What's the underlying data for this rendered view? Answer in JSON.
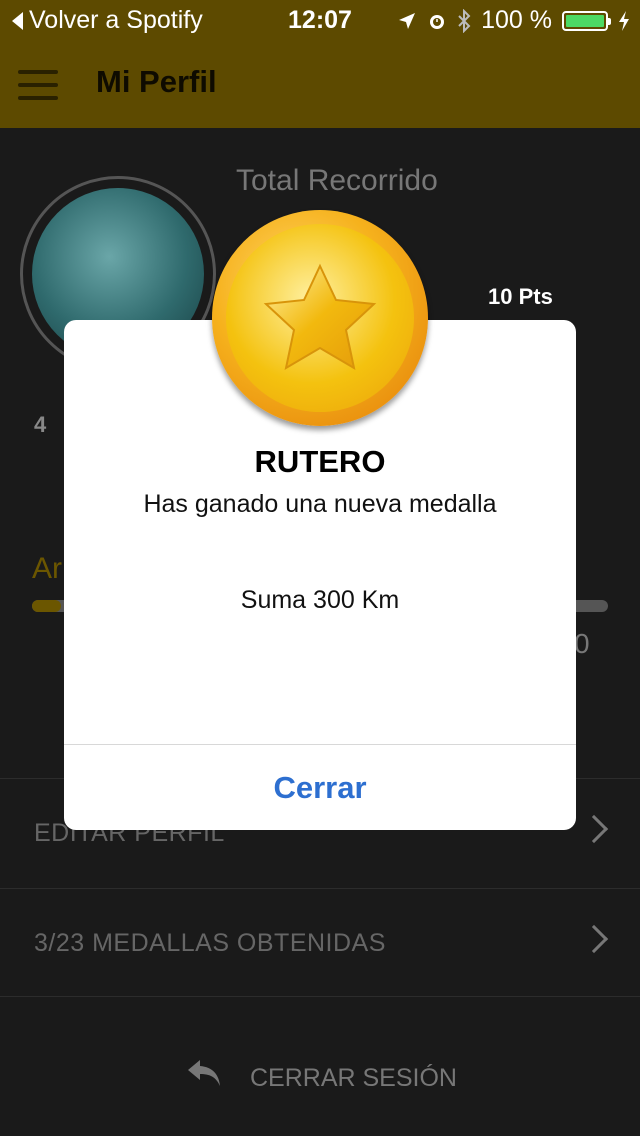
{
  "status_bar": {
    "back_label": "Volver a Spotify",
    "time": "12:07",
    "battery": "100 %",
    "icons": [
      "location-icon",
      "alarm-icon",
      "bluetooth-icon",
      "battery-icon",
      "charging-icon"
    ]
  },
  "nav": {
    "title": "Mi Perfil",
    "menu_icon": "hamburger-menu-icon"
  },
  "profile": {
    "total_label": "Total Recorrido",
    "total_value": "",
    "points": "10 Pts",
    "small_number": "4",
    "level_label": "Ar",
    "progress_end": "0",
    "progress_fraction": 0.05
  },
  "menu": {
    "edit_profile": "EDITAR PERFIL",
    "medals": "3/23 MEDALLAS OBTENIDAS",
    "logout": "CERRAR SESIÓN"
  },
  "modal": {
    "title": "RUTERO",
    "message": "Has ganado una nueva medalla",
    "detail": "Suma 300 Km",
    "button": "Cerrar",
    "medal_icon": "gold-star-medal-icon"
  },
  "colors": {
    "header": "#5d4a00",
    "accent_gold": "#f4c20f",
    "button_blue": "#2d6fd0",
    "battery_green": "#4cd964"
  }
}
